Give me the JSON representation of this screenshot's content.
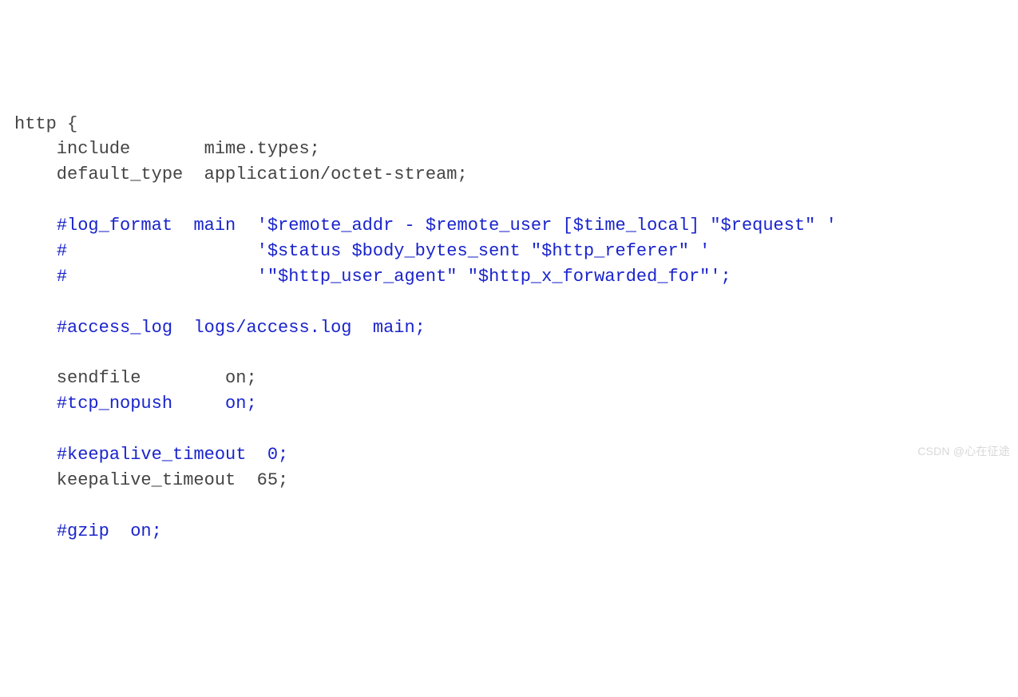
{
  "code": {
    "lines": [
      {
        "segments": [
          {
            "cls": "plain",
            "text": "http {"
          }
        ]
      },
      {
        "segments": [
          {
            "cls": "plain",
            "text": "    include       mime.types;"
          }
        ]
      },
      {
        "segments": [
          {
            "cls": "plain",
            "text": "    default_type  application/octet-stream;"
          }
        ]
      },
      {
        "segments": [
          {
            "cls": "plain",
            "text": ""
          }
        ]
      },
      {
        "segments": [
          {
            "cls": "plain",
            "text": "    "
          },
          {
            "cls": "comment",
            "text": "#log_format  main  '$remote_addr - $remote_user [$time_local] \"$request\" '"
          }
        ]
      },
      {
        "segments": [
          {
            "cls": "plain",
            "text": "    "
          },
          {
            "cls": "comment",
            "text": "#                  '$status $body_bytes_sent \"$http_referer\" '"
          }
        ]
      },
      {
        "segments": [
          {
            "cls": "plain",
            "text": "    "
          },
          {
            "cls": "comment",
            "text": "#                  '\"$http_user_agent\" \"$http_x_forwarded_for\"';"
          }
        ]
      },
      {
        "segments": [
          {
            "cls": "plain",
            "text": ""
          }
        ]
      },
      {
        "segments": [
          {
            "cls": "plain",
            "text": "    "
          },
          {
            "cls": "comment",
            "text": "#access_log  logs/access.log  main;"
          }
        ]
      },
      {
        "segments": [
          {
            "cls": "plain",
            "text": ""
          }
        ]
      },
      {
        "segments": [
          {
            "cls": "plain",
            "text": "    sendfile        on;"
          }
        ]
      },
      {
        "segments": [
          {
            "cls": "plain",
            "text": "    "
          },
          {
            "cls": "comment",
            "text": "#tcp_nopush     on;"
          }
        ]
      },
      {
        "segments": [
          {
            "cls": "plain",
            "text": ""
          }
        ]
      },
      {
        "segments": [
          {
            "cls": "plain",
            "text": "    "
          },
          {
            "cls": "comment",
            "text": "#keepalive_timeout  0;"
          }
        ]
      },
      {
        "segments": [
          {
            "cls": "plain",
            "text": "    keepalive_timeout  65;"
          }
        ]
      },
      {
        "segments": [
          {
            "cls": "plain",
            "text": ""
          }
        ]
      },
      {
        "segments": [
          {
            "cls": "plain",
            "text": "    "
          },
          {
            "cls": "comment",
            "text": "#gzip  on;"
          }
        ]
      }
    ]
  },
  "watermark": "CSDN @心在征途"
}
